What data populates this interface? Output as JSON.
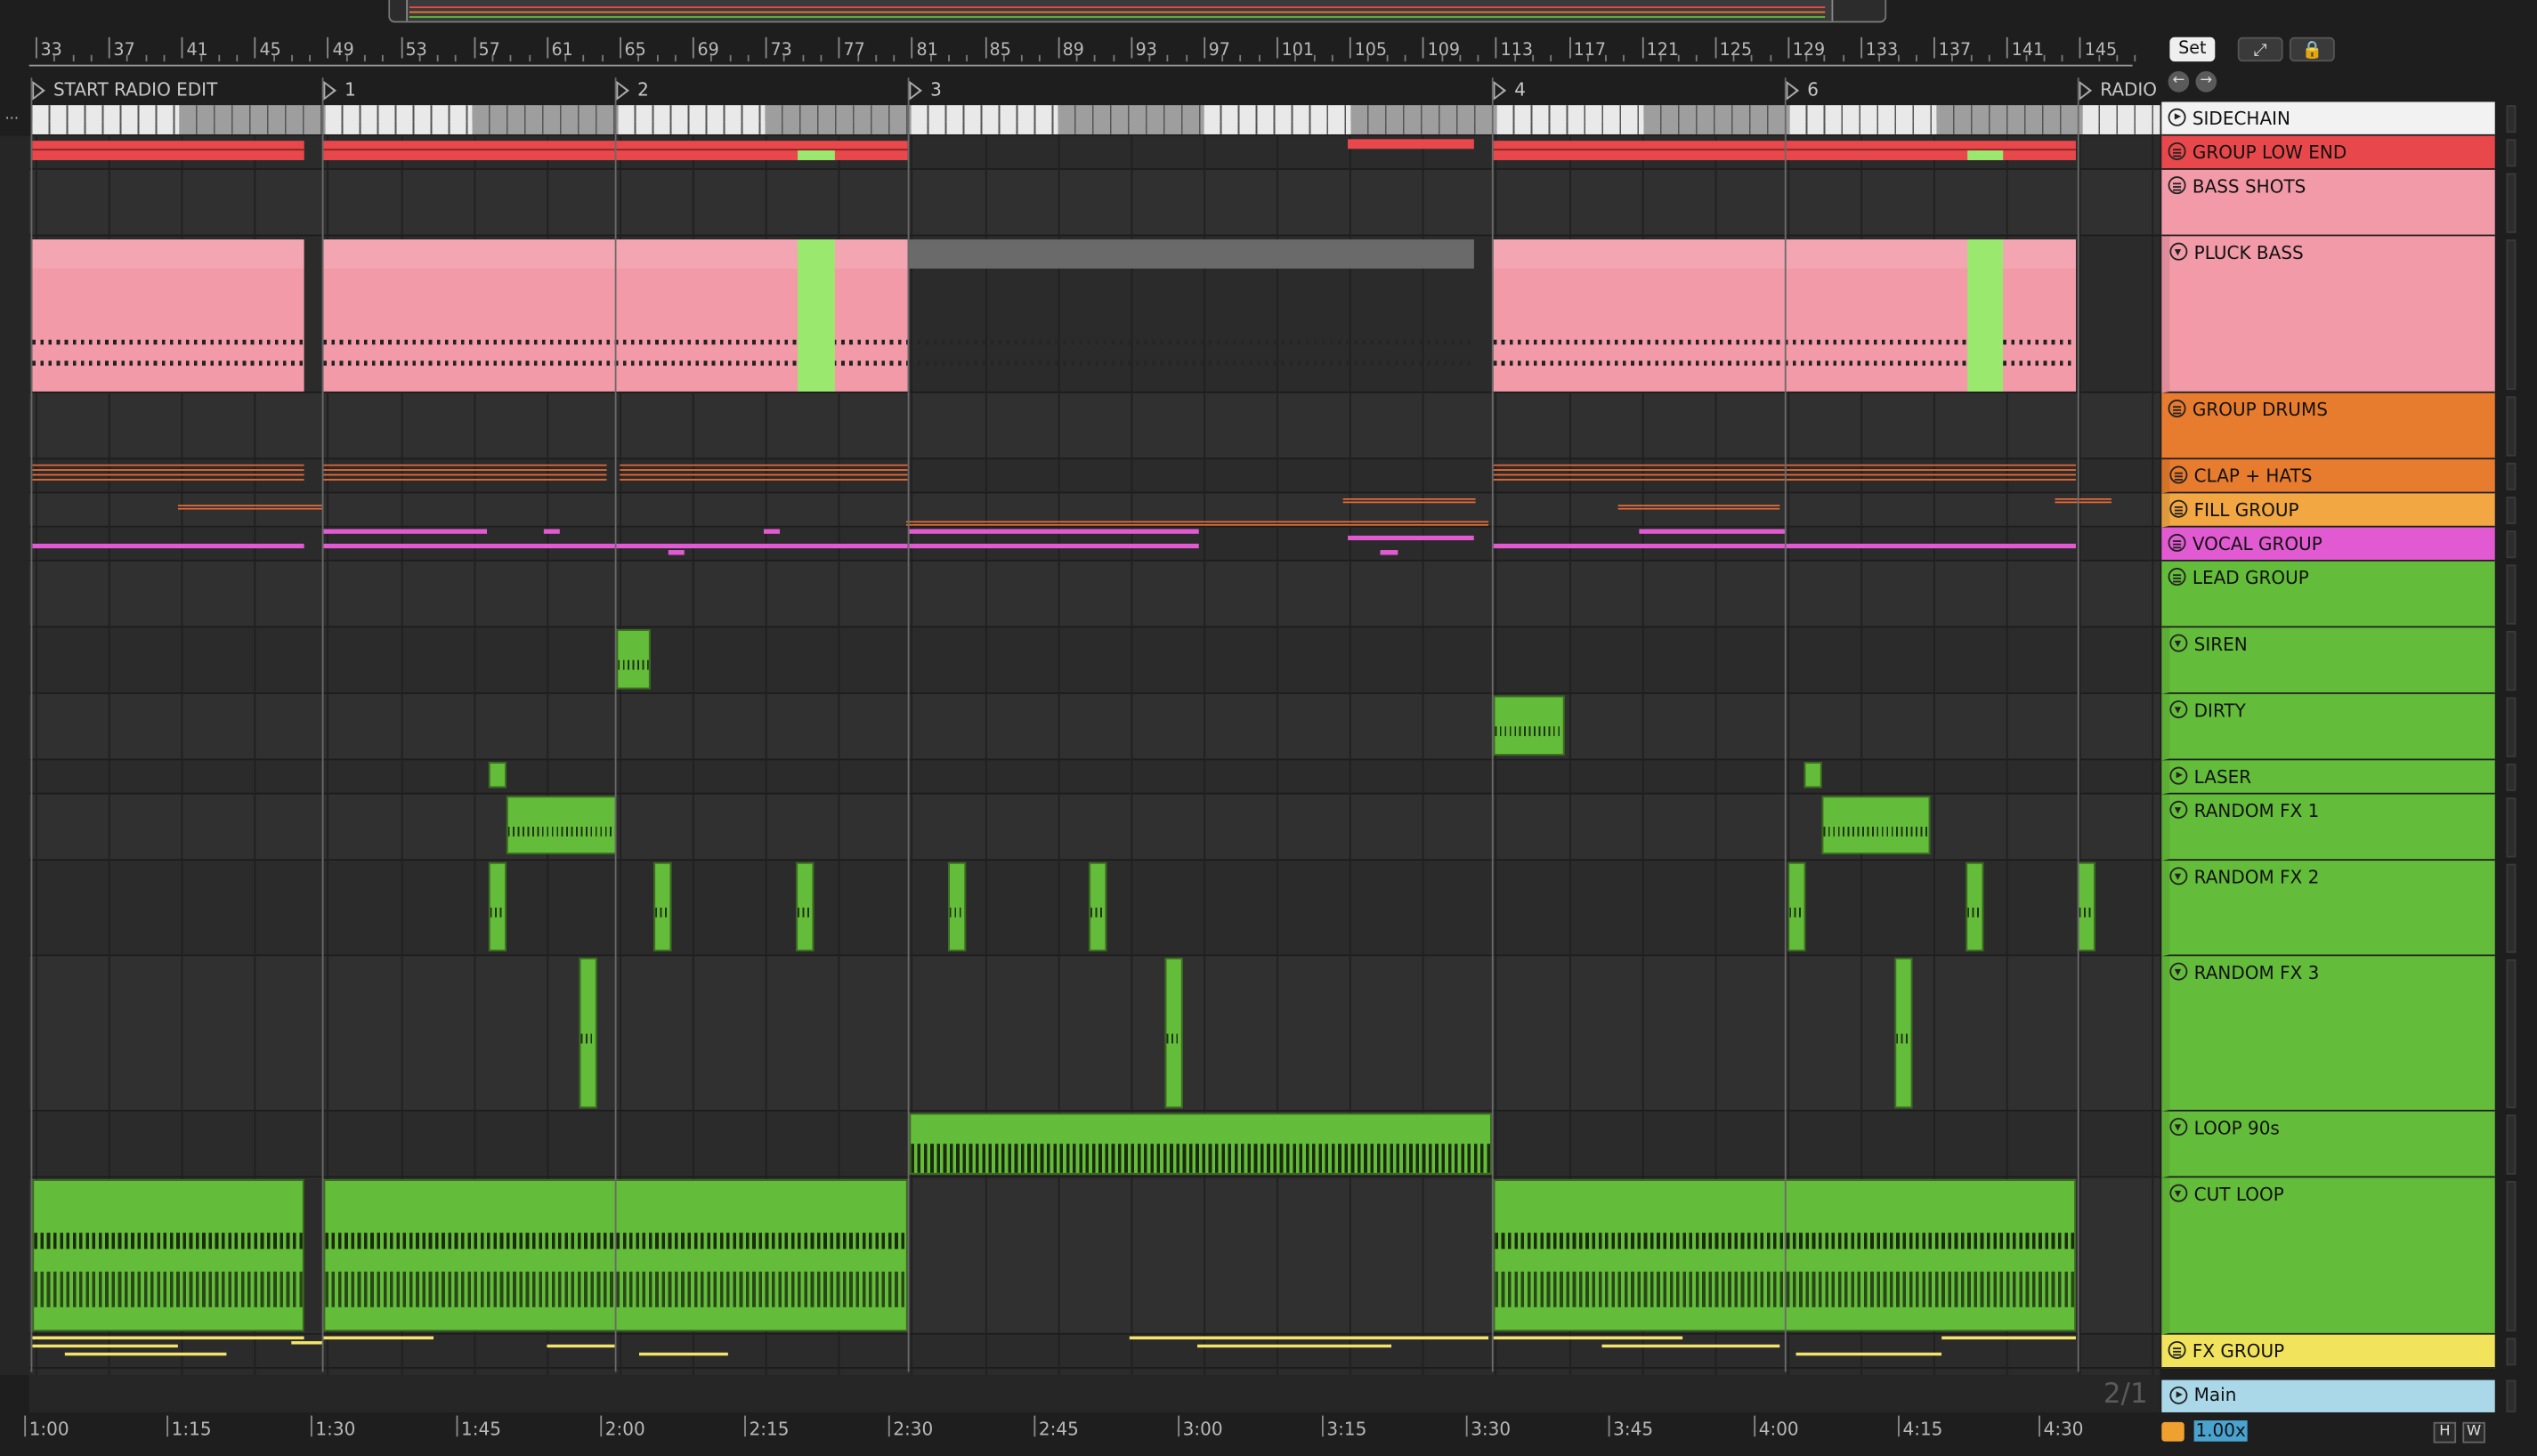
{
  "ruler": {
    "bars": [
      "33",
      "37",
      "41",
      "45",
      "49",
      "53",
      "57",
      "61",
      "65",
      "69",
      "73",
      "77",
      "81",
      "85",
      "89",
      "93",
      "97",
      "101",
      "105",
      "109",
      "113",
      "117",
      "121",
      "125",
      "129",
      "133",
      "137",
      "141",
      "145"
    ]
  },
  "locators": [
    "START RADIO EDIT",
    "1",
    "2",
    "3",
    "4",
    "6",
    "RADIO"
  ],
  "topbar": {
    "set_label": "Set",
    "expand_icon": "expand-icon",
    "lock_icon": "lock-icon"
  },
  "tracks": [
    {
      "name": "SIDECHAIN",
      "color": "#f2f2f2",
      "icon": "play"
    },
    {
      "name": "GROUP LOW END",
      "color": "#e8484b",
      "icon": "group"
    },
    {
      "name": "BASS SHOTS",
      "color": "#f29aa8",
      "icon": "group"
    },
    {
      "name": "PLUCK BASS",
      "color": "#f29aa8",
      "icon": "fold"
    },
    {
      "name": "GROUP DRUMS",
      "color": "#e87c2e",
      "icon": "group"
    },
    {
      "name": "CLAP + HATS",
      "color": "#e87c2e",
      "icon": "group"
    },
    {
      "name": "FILL GROUP",
      "color": "#f2a743",
      "icon": "group"
    },
    {
      "name": "VOCAL GROUP",
      "color": "#e25ad2",
      "icon": "group"
    },
    {
      "name": "LEAD GROUP",
      "color": "#64bd3a",
      "icon": "group"
    },
    {
      "name": "SIREN",
      "color": "#64bd3a",
      "icon": "fold"
    },
    {
      "name": "DIRTY",
      "color": "#64bd3a",
      "icon": "fold"
    },
    {
      "name": "LASER",
      "color": "#64bd3a",
      "icon": "play"
    },
    {
      "name": "RANDOM FX 1",
      "color": "#64bd3a",
      "icon": "fold"
    },
    {
      "name": "RANDOM FX 2",
      "color": "#64bd3a",
      "icon": "fold"
    },
    {
      "name": "RANDOM FX 3",
      "color": "#64bd3a",
      "icon": "fold"
    },
    {
      "name": "LOOP 90s",
      "color": "#64bd3a",
      "icon": "fold"
    },
    {
      "name": "CUT LOOP",
      "color": "#64bd3a",
      "icon": "fold"
    },
    {
      "name": "FX GROUP",
      "color": "#f2e35c",
      "icon": "group"
    }
  ],
  "main_track": {
    "name": "Main",
    "color": "#aad8e8"
  },
  "zoom_label": "2/1",
  "time_ruler": [
    "1:00",
    "1:15",
    "1:30",
    "1:45",
    "2:00",
    "2:15",
    "2:30",
    "2:45",
    "3:00",
    "3:15",
    "3:30",
    "3:45",
    "4:00",
    "4:15",
    "4:30"
  ],
  "tempo": {
    "value": "1.00x"
  },
  "bottom_buttons": {
    "h": "H",
    "w": "W"
  },
  "colors": {
    "red": "#e8484b",
    "pink": "#f29aa8",
    "orange": "#e87c2e",
    "magenta": "#e25ad2",
    "green": "#64bd3a",
    "lightgreen": "#9be86f",
    "yellow": "#f2e35c",
    "main": "#aad8e8",
    "bg": "#1e1e1e"
  }
}
